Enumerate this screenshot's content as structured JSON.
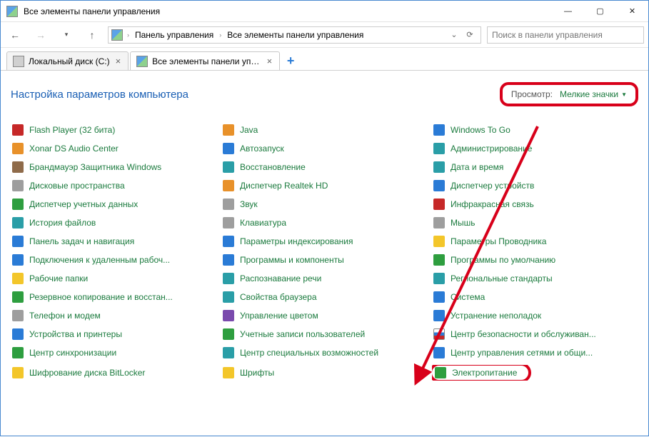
{
  "window": {
    "title": "Все элементы панели управления"
  },
  "controls": {
    "minimize": "—",
    "maximize": "▢",
    "close": "✕"
  },
  "breadcrumb": {
    "root": "Панель управления",
    "current": "Все элементы панели управления"
  },
  "search": {
    "placeholder": "Поиск в панели управления"
  },
  "tabs": {
    "t0": {
      "label": "Локальный диск (C:)"
    },
    "t1": {
      "label": "Все элементы панели управлен..."
    },
    "add": "+"
  },
  "header": {
    "title": "Настройка параметров компьютера",
    "view_label": "Просмотр:",
    "view_value": "Мелкие значки"
  },
  "items": {
    "c0": [
      {
        "label": "Flash Player (32 бита)",
        "icon": "c-red",
        "name": "flash"
      },
      {
        "label": "Xonar DS Audio Center",
        "icon": "c-orange",
        "name": "xonar"
      },
      {
        "label": "Брандмауэр Защитника Windows",
        "icon": "c-brown",
        "name": "firewall"
      },
      {
        "label": "Дисковые пространства",
        "icon": "c-gray",
        "name": "storagespaces"
      },
      {
        "label": "Диспетчер учетных данных",
        "icon": "c-green",
        "name": "credential"
      },
      {
        "label": "История файлов",
        "icon": "c-teal",
        "name": "filehistory"
      },
      {
        "label": "Панель задач и навигация",
        "icon": "c-blue",
        "name": "taskbar"
      },
      {
        "label": "Подключения к удаленным рабоч...",
        "icon": "c-blue",
        "name": "remoteapp"
      },
      {
        "label": "Рабочие папки",
        "icon": "c-yellow",
        "name": "workfolders"
      },
      {
        "label": "Резервное копирование и восстан...",
        "icon": "c-green",
        "name": "backup"
      },
      {
        "label": "Телефон и модем",
        "icon": "c-gray",
        "name": "phone"
      },
      {
        "label": "Устройства и принтеры",
        "icon": "c-blue",
        "name": "devices"
      },
      {
        "label": "Центр синхронизации",
        "icon": "c-green",
        "name": "synccenter"
      },
      {
        "label": "Шифрование диска BitLocker",
        "icon": "c-yellow",
        "name": "bitlocker"
      }
    ],
    "c1": [
      {
        "label": "Java",
        "icon": "c-orange",
        "name": "java"
      },
      {
        "label": "Автозапуск",
        "icon": "c-blue",
        "name": "autoplay"
      },
      {
        "label": "Восстановление",
        "icon": "c-teal",
        "name": "recovery"
      },
      {
        "label": "Диспетчер Realtek HD",
        "icon": "c-orange",
        "name": "realtek"
      },
      {
        "label": "Звук",
        "icon": "c-gray",
        "name": "sound"
      },
      {
        "label": "Клавиатура",
        "icon": "c-gray",
        "name": "keyboard"
      },
      {
        "label": "Параметры индексирования",
        "icon": "c-blue",
        "name": "indexing"
      },
      {
        "label": "Программы и компоненты",
        "icon": "c-blue",
        "name": "programs"
      },
      {
        "label": "Распознавание речи",
        "icon": "c-teal",
        "name": "speech"
      },
      {
        "label": "Свойства браузера",
        "icon": "c-teal",
        "name": "internet"
      },
      {
        "label": "Управление цветом",
        "icon": "c-purple",
        "name": "color"
      },
      {
        "label": "Учетные записи пользователей",
        "icon": "c-green",
        "name": "users"
      },
      {
        "label": "Центр специальных возможностей",
        "icon": "c-teal",
        "name": "easeaccess"
      },
      {
        "label": "Шрифты",
        "icon": "c-yellow",
        "name": "fonts"
      }
    ],
    "c2": [
      {
        "label": "Windows To Go",
        "icon": "c-blue",
        "name": "wintogo"
      },
      {
        "label": "Администрирование",
        "icon": "c-teal",
        "name": "admin"
      },
      {
        "label": "Дата и время",
        "icon": "c-teal",
        "name": "datetime"
      },
      {
        "label": "Диспетчер устройств",
        "icon": "c-blue",
        "name": "devmgr"
      },
      {
        "label": "Инфракрасная связь",
        "icon": "c-red",
        "name": "infrared"
      },
      {
        "label": "Мышь",
        "icon": "c-gray",
        "name": "mouse"
      },
      {
        "label": "Параметры Проводника",
        "icon": "c-yellow",
        "name": "folderopt"
      },
      {
        "label": "Программы по умолчанию",
        "icon": "c-green",
        "name": "defaults"
      },
      {
        "label": "Региональные стандарты",
        "icon": "c-teal",
        "name": "region"
      },
      {
        "label": "Система",
        "icon": "c-blue",
        "name": "system"
      },
      {
        "label": "Устранение неполадок",
        "icon": "c-blue",
        "name": "troubleshoot"
      },
      {
        "label": "Центр безопасности и обслуживан...",
        "icon": "c-flag",
        "name": "security"
      },
      {
        "label": "Центр управления сетями и общи...",
        "icon": "c-blue",
        "name": "network"
      },
      {
        "label": "Электропитание",
        "icon": "c-green",
        "name": "power",
        "highlight": true
      }
    ]
  }
}
